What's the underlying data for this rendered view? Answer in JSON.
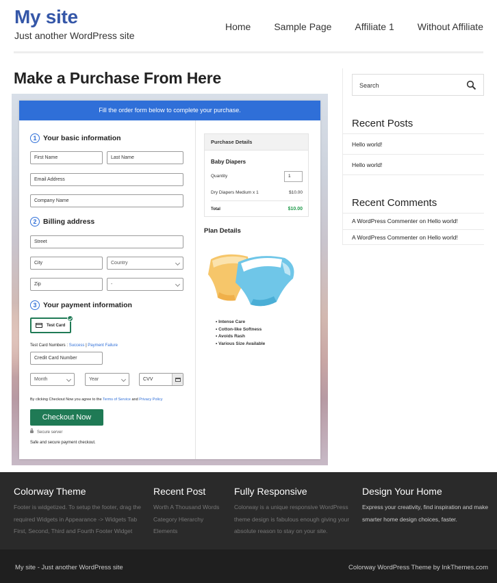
{
  "header": {
    "site_title": "My site",
    "tagline": "Just another WordPress site",
    "nav": [
      "Home",
      "Sample Page",
      "Affiliate 1",
      "Without Affiliate"
    ]
  },
  "main": {
    "page_title": "Make a Purchase From Here",
    "form": {
      "banner": "Fill the order form below to complete your purchase.",
      "step1": {
        "num": "1",
        "title": "Your basic information"
      },
      "first_name": "First Name",
      "last_name": "Last Name",
      "email": "Email Address",
      "company": "Company Name",
      "step2": {
        "num": "2",
        "title": "Billing address"
      },
      "street": "Street",
      "city": "City",
      "country": "Country",
      "zip": "Zip",
      "state": "-",
      "step3": {
        "num": "3",
        "title": "Your payment information"
      },
      "card_option": "Test Card",
      "test_numbers_label": "Test Card Numbers :",
      "success_link": "Success",
      "separator": "|",
      "failure_link": "Payment Failure",
      "card_number": "Credit Card Number",
      "month": "Month",
      "year": "Year",
      "cvv": "CVV",
      "terms_prefix": "By clicking Checkout Now you agree to the",
      "terms_link": "Terms of Service",
      "terms_and": "and",
      "privacy_link": "Privacy Policy",
      "checkout_button": "Checkout Now",
      "secure_server": "Secure server",
      "safe_text": "Safe and secure payment checkout."
    },
    "purchase": {
      "header": "Purchase Details",
      "product": "Baby Diapers",
      "quantity_label": "Quantity",
      "quantity": "1",
      "item": "Dry Diapers Medium x 1",
      "item_price": "$10.00",
      "total_label": "Total",
      "total": "$10.00"
    },
    "plan": {
      "title": "Plan Details",
      "features": [
        "Intense Care",
        "Cotton-like Softness",
        "Avoids Rash",
        "Various Size Available"
      ]
    }
  },
  "sidebar": {
    "search_placeholder": "Search",
    "recent_posts_title": "Recent Posts",
    "recent_posts": [
      "Hello world!",
      "Hello world!"
    ],
    "recent_comments_title": "Recent Comments",
    "recent_comments": [
      {
        "author": "A WordPress Commenter",
        "on": "on",
        "post": "Hello world!"
      },
      {
        "author": "A WordPress Commenter",
        "on": "on",
        "post": "Hello world!"
      }
    ]
  },
  "footer": {
    "cols": [
      {
        "title": "Colorway Theme",
        "text": "Footer is widgetized. To setup the footer, drag the required Widgets in Appearance -> Widgets Tab First, Second, Third and Fourth Footer Widget"
      },
      {
        "title": "Recent Post",
        "text": "Worth A Thousand Words Category Hierarchy Elements"
      },
      {
        "title": "Fully Responsive",
        "text": "Colorway is a unique responsive WordPress theme design is fabulous enough giving your absolute reason to stay on your site."
      },
      {
        "title": "Design Your Home",
        "text": "Express your creativity, find inspiration and make smarter home design choices, faster."
      }
    ],
    "bottom_left": "My site - Just another WordPress site",
    "bottom_right": "Colorway WordPress Theme by InkThemes.com"
  },
  "colors": {
    "brand_blue": "#3557a8",
    "form_blue": "#2f6fd8",
    "checkout_green": "#1f7a55",
    "price_green": "#1f9a4a"
  }
}
